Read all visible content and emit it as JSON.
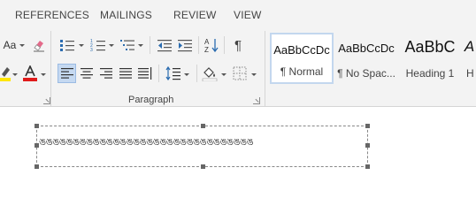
{
  "tabs": [
    {
      "label": "REFERENCES"
    },
    {
      "label": "MAILINGS"
    },
    {
      "label": "REVIEW"
    },
    {
      "label": "VIEW"
    }
  ],
  "ribbon": {
    "font_partial": {
      "font_size_label": "Aa"
    },
    "paragraph": {
      "group_label": "Paragraph",
      "show_marks_glyph": "¶"
    },
    "styles": [
      {
        "preview": "AaBbCcDc",
        "name": "¶ Normal"
      },
      {
        "preview": "AaBbCcDc",
        "name": "¶ No Spac..."
      },
      {
        "preview": "AaBbC",
        "name": "Heading 1"
      },
      {
        "preview": "A",
        "name": "H"
      }
    ]
  },
  "colors": {
    "highlight": "#ffe600",
    "font_color": "#e01b1b",
    "selected_tile_border": "#c3d7ee"
  },
  "document": {
    "textbox_content": "ঙঙঙঙঙঙঙঙঙঙঙঙঙঙঙঙঙঙঙঙঙঙঙঙঙঙঙঙঙঙঙঙ"
  }
}
